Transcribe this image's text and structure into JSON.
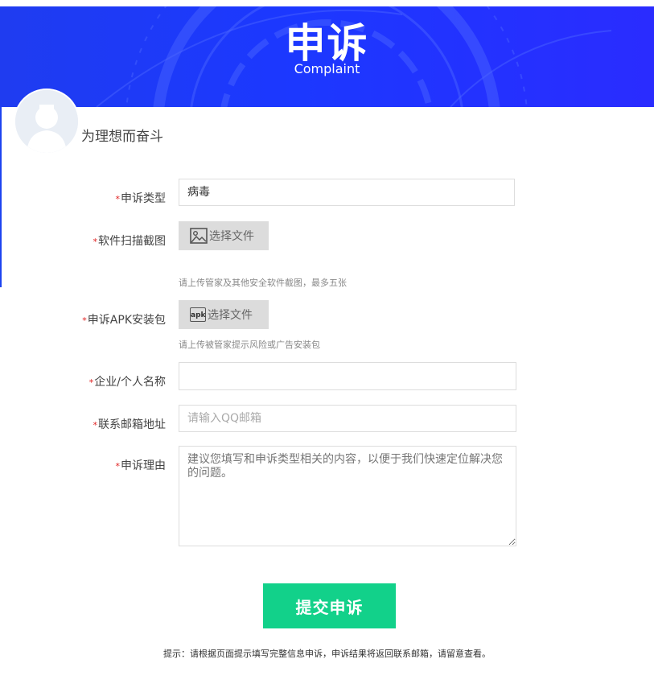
{
  "banner": {
    "title": "申诉",
    "subtitle": "Complaint"
  },
  "user": {
    "name": "为理想而奋斗"
  },
  "form": {
    "required_mark": "*",
    "complaint_type": {
      "label": "申诉类型",
      "value": "病毒"
    },
    "screenshot": {
      "label": "软件扫描截图",
      "button": "选择文件",
      "hint": "请上传管家及其他安全软件截图，最多五张"
    },
    "apk": {
      "label": "申诉APK安装包",
      "icon_text": "apk",
      "button": "选择文件",
      "hint": "请上传被管家提示风险或广告安装包"
    },
    "company": {
      "label": "企业/个人名称",
      "value": ""
    },
    "email": {
      "label": "联系邮箱地址",
      "placeholder": "请输入QQ邮箱"
    },
    "reason": {
      "label": "申诉理由",
      "placeholder": "建议您填写和申诉类型相关的内容，以便于我们快速定位解决您的问题。"
    }
  },
  "submit_label": "提交申诉",
  "footer_tip": "提示：请根据页面提示填写完整信息申诉，申诉结果将返回联系邮箱，请留意查看。",
  "colors": {
    "banner": "#1c38ff",
    "submit": "#12d18a",
    "required": "#e02020"
  }
}
